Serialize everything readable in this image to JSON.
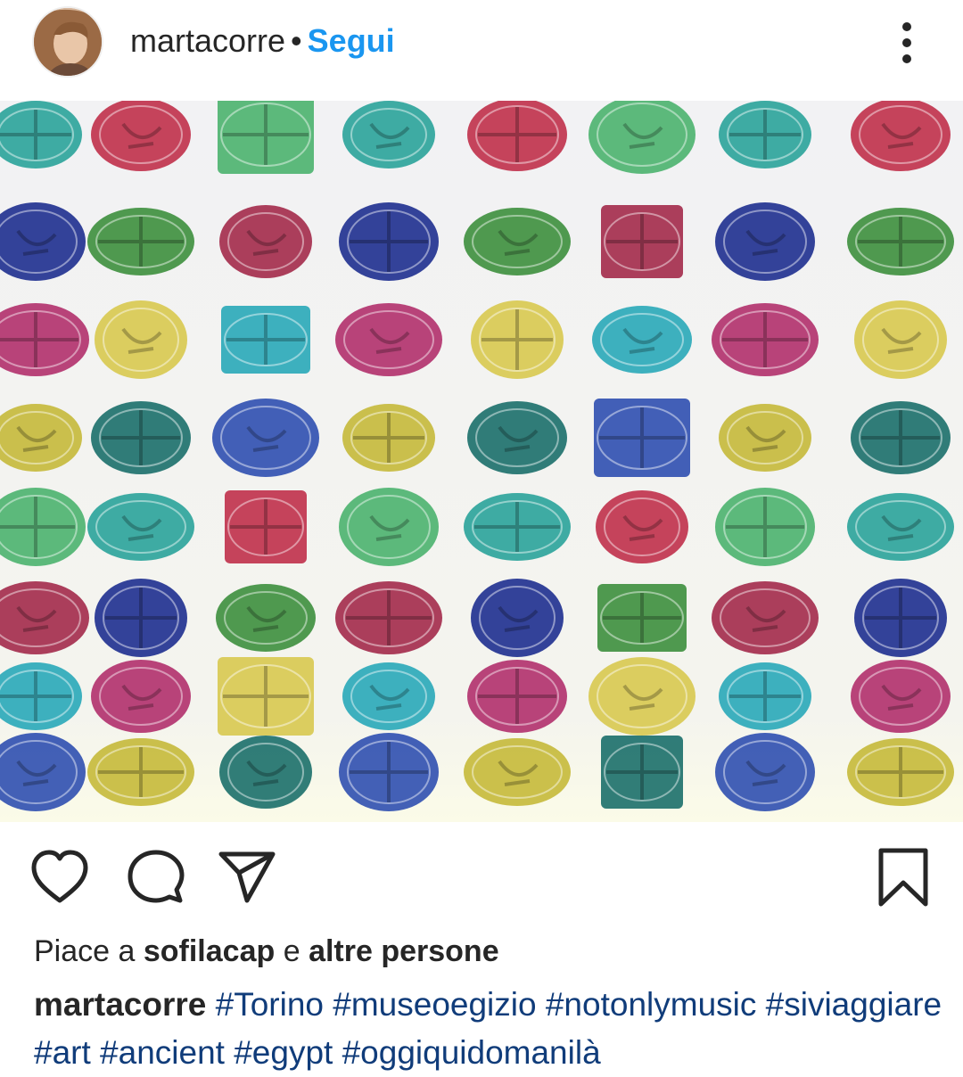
{
  "post": {
    "username": "martacorre",
    "separator": "•",
    "follow_label": "Segui",
    "image_alt": "Wall of colorful ancient Egyptian scarab seals at Museo Egizio"
  },
  "icons": {
    "avatar": "user-avatar",
    "more": "more-options-icon",
    "like": "heart-icon",
    "comment": "comment-icon",
    "share": "send-icon",
    "save": "bookmark-icon"
  },
  "likes": {
    "prefix": "Piace a",
    "user": "sofilacap",
    "joiner": "e",
    "others": "altre persone"
  },
  "caption": {
    "user": "martacorre",
    "hashtags": [
      "#Torino",
      "#museoegizio",
      "#notonlymusic",
      "#siviaggiare",
      "#art",
      "#ancient",
      "#egypt",
      "#oggiquidomanilà"
    ]
  },
  "colors": {
    "follow": "#1a96f0",
    "hashtag": "#103c7a",
    "text": "#262626",
    "photo_background": "#efeff0"
  },
  "photo_palette": [
    "#2aa39a",
    "#1e2f8f",
    "#b1306b",
    "#c5b93a",
    "#4bb36e",
    "#a32a4a",
    "#29a8b8",
    "#2f4fb0",
    "#c0304a",
    "#3d8f3d",
    "#d8c94f",
    "#1b6f6a"
  ]
}
